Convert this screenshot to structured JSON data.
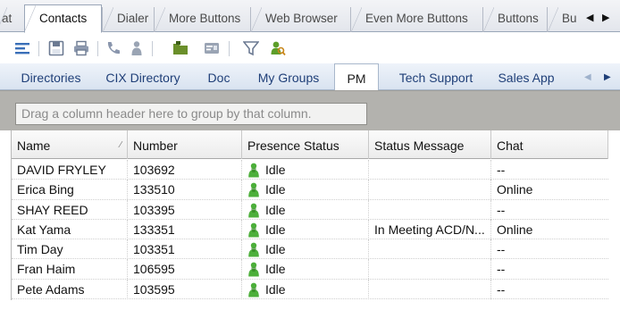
{
  "tabs": {
    "cut_label": "at",
    "items": [
      {
        "label": "Contacts",
        "active": true
      },
      {
        "label": "Dialer",
        "active": false
      },
      {
        "label": "More Buttons",
        "active": false
      },
      {
        "label": "Web Browser",
        "active": false
      },
      {
        "label": "Even More Buttons",
        "active": false
      },
      {
        "label": "Buttons",
        "active": false
      },
      {
        "label": "Bu",
        "active": false
      }
    ],
    "scroll_left_glyph": "◀",
    "scroll_right_glyph": "▶"
  },
  "toolbar": {
    "icons": [
      "menu-icon",
      "save-icon",
      "print-icon",
      "phone-icon",
      "presence-icon",
      "folder-icon",
      "card-icon",
      "filter-icon",
      "search-person-icon"
    ]
  },
  "subtabs": {
    "items": [
      {
        "label": "Directories",
        "active": false
      },
      {
        "label": "CIX Directory",
        "active": false
      },
      {
        "label": "Doc",
        "active": false
      },
      {
        "label": "My Groups",
        "active": false
      },
      {
        "label": "PM",
        "active": true
      },
      {
        "label": "Tech Support",
        "active": false
      },
      {
        "label": "Sales App",
        "active": false
      }
    ],
    "scroll_left_glyph": "◀",
    "scroll_right_glyph": "▶"
  },
  "group_panel": {
    "hint": "Drag a column header here to group by that column."
  },
  "grid": {
    "columns": [
      "Name",
      "Number",
      "Presence Status",
      "Status Message",
      "Chat"
    ],
    "sort_glyph": "∕",
    "rows": [
      {
        "name": "DAVID FRYLEY",
        "number": "103692",
        "presence": "Idle",
        "status_message": "",
        "chat": "--"
      },
      {
        "name": "Erica Bing",
        "number": "133510",
        "presence": "Idle",
        "status_message": "",
        "chat": "Online"
      },
      {
        "name": "SHAY REED",
        "number": "103395",
        "presence": "Idle",
        "status_message": "",
        "chat": "--"
      },
      {
        "name": "Kat Yama",
        "number": "133351",
        "presence": "Idle",
        "status_message": "In Meeting ACD/N...",
        "chat": "Online"
      },
      {
        "name": "Tim Day",
        "number": "103351",
        "presence": "Idle",
        "status_message": "",
        "chat": "--"
      },
      {
        "name": "Fran Haim",
        "number": "106595",
        "presence": "Idle",
        "status_message": "",
        "chat": "--"
      },
      {
        "name": "Pete Adams",
        "number": "103595",
        "presence": "Idle",
        "status_message": "",
        "chat": "--"
      }
    ]
  },
  "colors": {
    "subtab_text": "#1f3f78",
    "group_panel_bg": "#b3b2ae",
    "presence_idle": "#4caf3a"
  }
}
